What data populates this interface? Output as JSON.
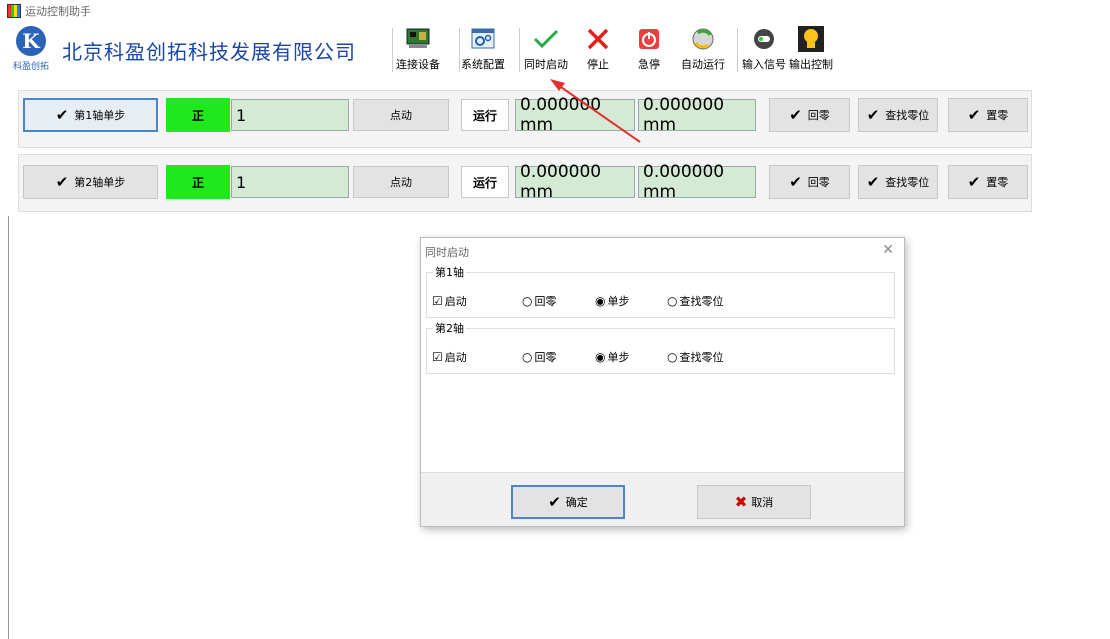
{
  "window": {
    "title": "运动控制助手"
  },
  "toolbar": {
    "logo_text": "科盈创拓",
    "company_name": "北京科盈创拓科技发展有限公司",
    "buttons": [
      {
        "label": "连接设备",
        "icon": "circuit-board-icon"
      },
      {
        "label": "系统配置",
        "icon": "settings-window-icon"
      },
      {
        "label": "同时启动",
        "icon": "check-icon"
      },
      {
        "label": "停止",
        "icon": "close-icon"
      },
      {
        "label": "急停",
        "icon": "power-icon"
      },
      {
        "label": "自动运行",
        "icon": "auto-run-icon"
      },
      {
        "label": "输入信号",
        "icon": "toggle-icon"
      },
      {
        "label": "输出控制",
        "icon": "lightbulb-icon"
      }
    ]
  },
  "axes": [
    {
      "step_label": "第1轴单步",
      "direction": "正",
      "step_value": "1",
      "jog_label": "点动",
      "run_label": "运行",
      "position1": "0.000000 mm",
      "position2": "0.000000 mm",
      "home_label": "回零",
      "find_zero_label": "查找零位",
      "set_zero_label": "置零"
    },
    {
      "step_label": "第2轴单步",
      "direction": "正",
      "step_value": "1",
      "jog_label": "点动",
      "run_label": "运行",
      "position1": "0.000000 mm",
      "position2": "0.000000 mm",
      "home_label": "回零",
      "find_zero_label": "查找零位",
      "set_zero_label": "置零"
    }
  ],
  "dialog": {
    "title": "同时启动",
    "groups": [
      {
        "title": "第1轴",
        "enable_label": "启动",
        "enabled": true,
        "opt_home": "回零",
        "opt_step": "单步",
        "opt_find": "查找零位",
        "selected": "单步"
      },
      {
        "title": "第2轴",
        "enable_label": "启动",
        "enabled": true,
        "opt_home": "回零",
        "opt_step": "单步",
        "opt_find": "查找零位",
        "selected": "单步"
      }
    ],
    "ok_label": "确定",
    "cancel_label": "取消"
  },
  "colors": {
    "accent": "#4a86c8",
    "brand": "#1a46a8",
    "direction_green": "#1de91d",
    "field_green": "#d5ead5",
    "annotation_red": "#e03030"
  }
}
